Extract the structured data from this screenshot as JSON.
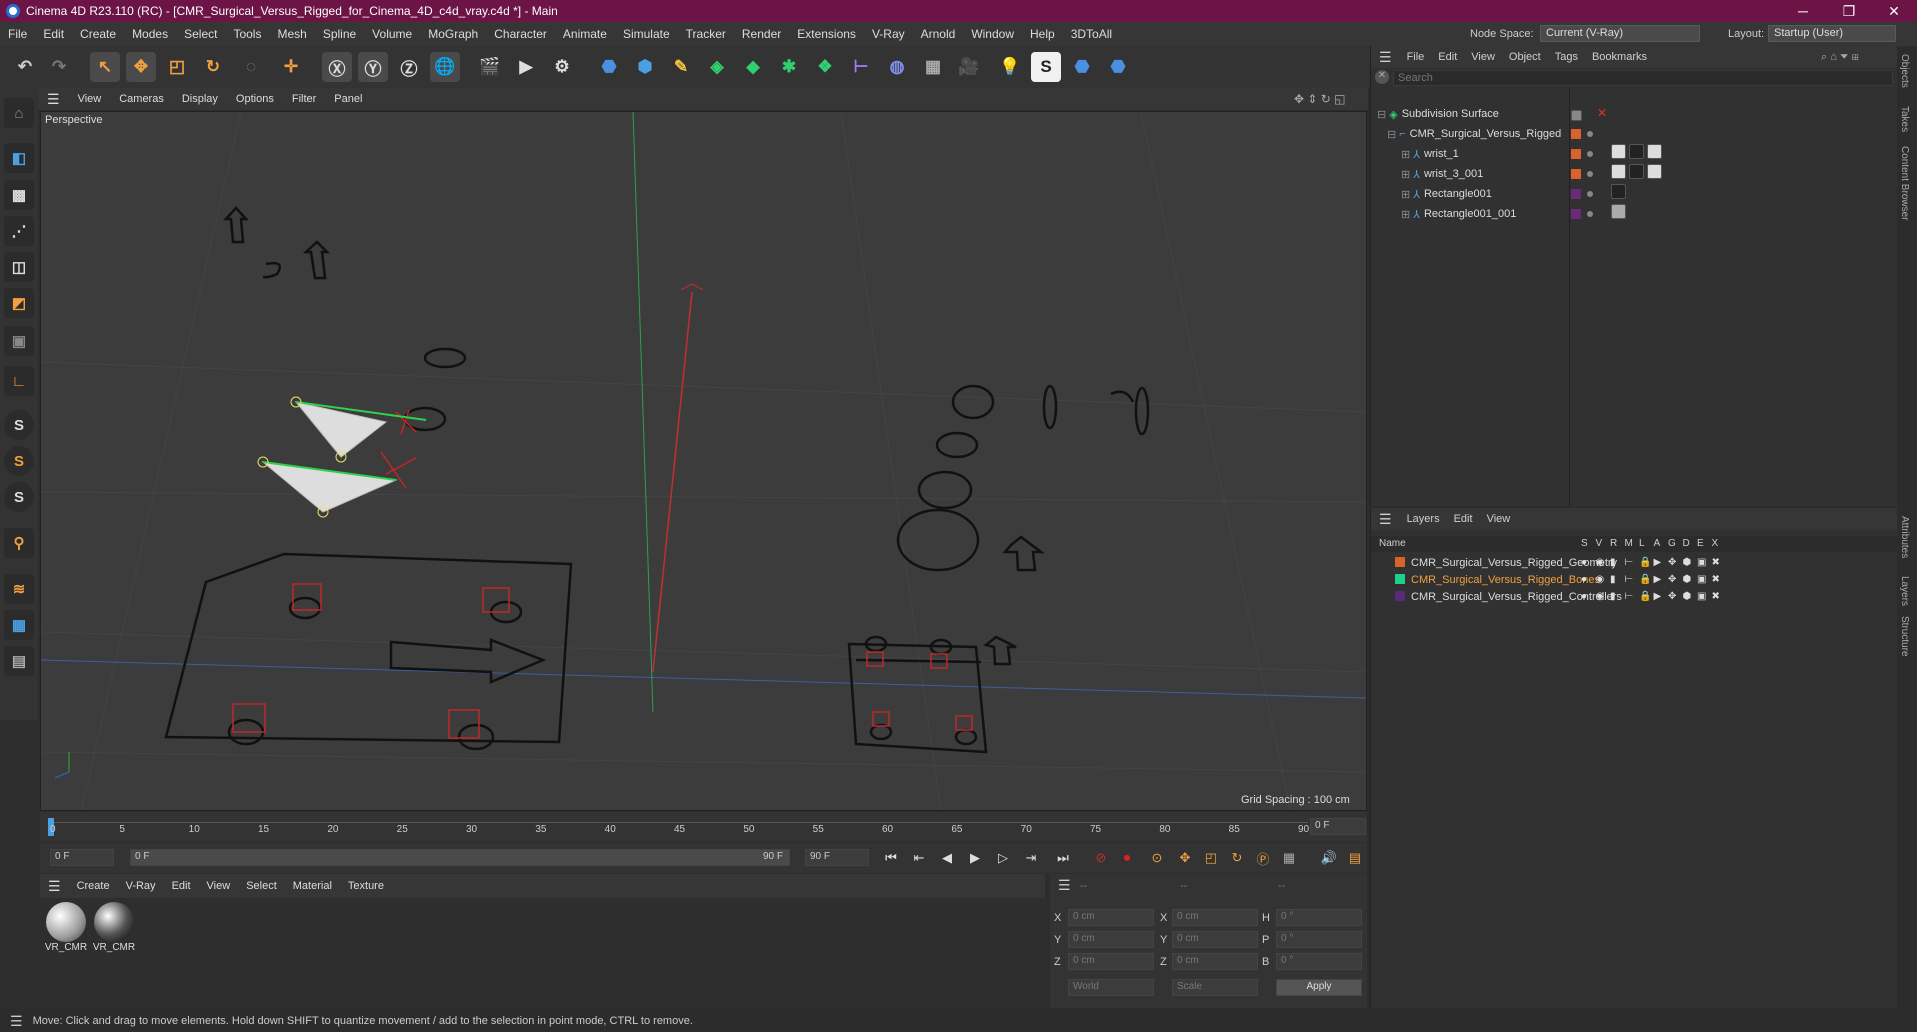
{
  "window": {
    "title": "Cinema 4D R23.110 (RC) - [CMR_Surgical_Versus_Rigged_for_Cinema_4D_c4d_vray.c4d *] - Main",
    "minimize": "─",
    "maximize": "❐",
    "close": "✕"
  },
  "menu": [
    "File",
    "Edit",
    "Create",
    "Modes",
    "Select",
    "Tools",
    "Mesh",
    "Spline",
    "Volume",
    "MoGraph",
    "Character",
    "Animate",
    "Simulate",
    "Tracker",
    "Render",
    "Extensions",
    "V-Ray",
    "Arnold",
    "Window",
    "Help",
    "3DToAll"
  ],
  "node_space": {
    "label": "Node Space:",
    "value": "Current (V-Ray)"
  },
  "layout": {
    "label": "Layout:",
    "value": "Startup (User)"
  },
  "viewport_menu": [
    "View",
    "Cameras",
    "Display",
    "Options",
    "Filter",
    "Panel"
  ],
  "viewport": {
    "name": "Perspective",
    "grid_spacing": "Grid Spacing : 100 cm"
  },
  "timeline": {
    "ticks": [
      "0",
      "5",
      "10",
      "15",
      "20",
      "25",
      "30",
      "35",
      "40",
      "45",
      "50",
      "55",
      "60",
      "65",
      "70",
      "75",
      "80",
      "85",
      "90"
    ],
    "current_frame": "0 F"
  },
  "playbar": {
    "start": "0 F",
    "range_start": "0 F",
    "range_end": "90 F",
    "end": "90 F"
  },
  "material_menu": [
    "Create",
    "V-Ray",
    "Edit",
    "View",
    "Select",
    "Material",
    "Texture"
  ],
  "materials": [
    {
      "name": "VR_CMR"
    },
    {
      "name": "VR_CMR"
    }
  ],
  "coords": {
    "headers": [
      "--",
      "--",
      "--"
    ],
    "rows": [
      {
        "a": "X",
        "v1": "0 cm",
        "b": "X",
        "v2": "0 cm",
        "c": "H",
        "v3": "0 °"
      },
      {
        "a": "Y",
        "v1": "0 cm",
        "b": "Y",
        "v2": "0 cm",
        "c": "P",
        "v3": "0 °"
      },
      {
        "a": "Z",
        "v1": "0 cm",
        "b": "Z",
        "v2": "0 cm",
        "c": "B",
        "v3": "0 °"
      }
    ],
    "mode1": "World",
    "mode2": "Scale",
    "apply": "Apply"
  },
  "objects": {
    "menu": [
      "File",
      "Edit",
      "View",
      "Object",
      "Tags",
      "Bookmarks"
    ],
    "search_placeholder": "Search",
    "items": [
      {
        "name": "Subdivision Surface",
        "color": "#000000"
      },
      {
        "name": "CMR_Surgical_Versus_Rigged",
        "color": "#d9622b"
      },
      {
        "name": "wrist_1",
        "color": "#d9622b"
      },
      {
        "name": "wrist_3_001",
        "color": "#d9622b"
      },
      {
        "name": "Rectangle001",
        "color": "#6a2a7a"
      },
      {
        "name": "Rectangle001_001",
        "color": "#6a2a7a"
      }
    ]
  },
  "layers": {
    "menu": [
      "Layers",
      "Edit",
      "View"
    ],
    "col_name": "Name",
    "cols": [
      "S",
      "V",
      "R",
      "M",
      "L",
      "A",
      "G",
      "D",
      "E",
      "X"
    ],
    "items": [
      {
        "name": "CMR_Surgical_Versus_Rigged_Geometry",
        "color": "#d9622b"
      },
      {
        "name": "CMR_Surgical_Versus_Rigged_Bones",
        "color": "#1fd08a"
      },
      {
        "name": "CMR_Surgical_Versus_Rigged_Controllers",
        "color": "#5a2a7a"
      }
    ]
  },
  "right_tabs": [
    "Objects",
    "Takes",
    "Content Browser",
    "Attributes",
    "Layers",
    "Structure"
  ],
  "status": "Move: Click and drag to move elements. Hold down SHIFT to quantize movement / add to the selection in point mode, CTRL to remove."
}
